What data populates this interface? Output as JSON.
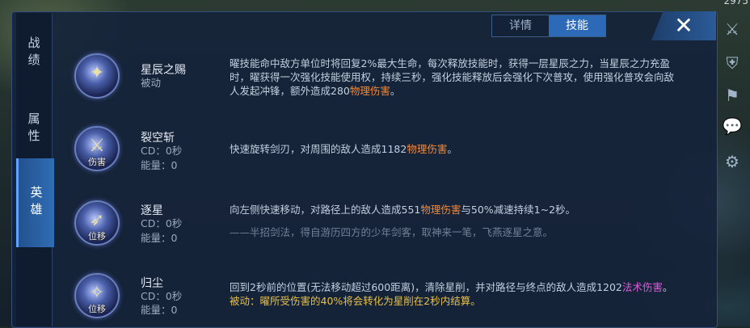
{
  "header": {
    "top_number": "2975",
    "tabs": [
      "详情",
      "技能"
    ],
    "active_tab": "技能",
    "close_symbol": "✕"
  },
  "side_tabs": [
    "战绩",
    "属性",
    "英雄"
  ],
  "active_side_tab": "英雄",
  "skills": [
    {
      "name": "星辰之赐",
      "type": "被动",
      "icon_tag": "",
      "desc_parts": [
        {
          "text": "曜技能命中敌方单位时将回复2%最大生命，每次释放技能时，获得一层星辰之力，当星辰之力充盈时，曜获得一次强化技能使用权，持续三秒，强化技能释放后会强化下次普攻，使用强化普攻会向敌人发起冲锋，额外造成280",
          "style": "normal"
        },
        {
          "text": "物理伤害",
          "style": "orange"
        },
        {
          "text": "。",
          "style": "normal"
        }
      ]
    },
    {
      "name": "裂空斩",
      "cd": "CD：0秒",
      "energy": "能量：0",
      "icon_tag": "伤害",
      "desc_parts": [
        {
          "text": "快速旋转剑刃，对周围的敌人造成1182",
          "style": "normal"
        },
        {
          "text": "物理伤害",
          "style": "orange"
        },
        {
          "text": "。",
          "style": "normal"
        }
      ]
    },
    {
      "name": "逐星",
      "cd": "CD：0秒",
      "energy": "能量：0",
      "icon_tag": "位移",
      "desc_parts": [
        {
          "text": "向左侧快速移动，对路径上的敌人造成551",
          "style": "normal"
        },
        {
          "text": "物理伤害",
          "style": "orange"
        },
        {
          "text": "与50%减速持续1~2秒。",
          "style": "normal"
        }
      ],
      "quote": "——半招剑法，得自游历四方的少年剑客，取神来一笔，飞燕逐星之意。"
    },
    {
      "name": "归尘",
      "cd": "CD：0秒",
      "energy": "能量：0",
      "icon_tag": "位移",
      "desc_parts": [
        {
          "text": "回到2秒前的位置(无法移动超过600距离)，清除星削，并对路径与终点的敌人造成1202",
          "style": "normal"
        },
        {
          "text": "法术伤害",
          "style": "magenta"
        },
        {
          "text": "。",
          "style": "normal"
        }
      ],
      "extra": "被动：曜所受伤害的40%将会转化为星削在2秒内结算。"
    }
  ],
  "colors": {
    "accent": "#2c6ab7",
    "physical_damage": "#f08a3c",
    "magic_damage": "#e25adf",
    "passive_note": "#e8c04a"
  }
}
